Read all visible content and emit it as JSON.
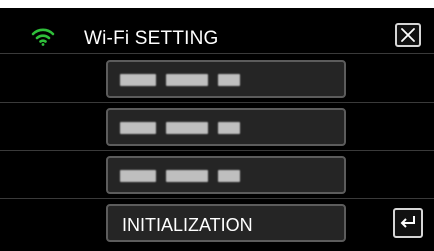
{
  "header": {
    "title": "Wi-Fi SETTING",
    "wifi_icon": "wifi-icon",
    "close_icon": "close-icon",
    "accent_color": "#2fbf3a"
  },
  "menu": {
    "items": [
      {
        "label": "",
        "redacted": true
      },
      {
        "label": "",
        "redacted": true
      },
      {
        "label": "",
        "redacted": true
      },
      {
        "label": "INITIALIZATION",
        "redacted": false
      }
    ]
  },
  "footer": {
    "back_icon": "return-icon"
  }
}
